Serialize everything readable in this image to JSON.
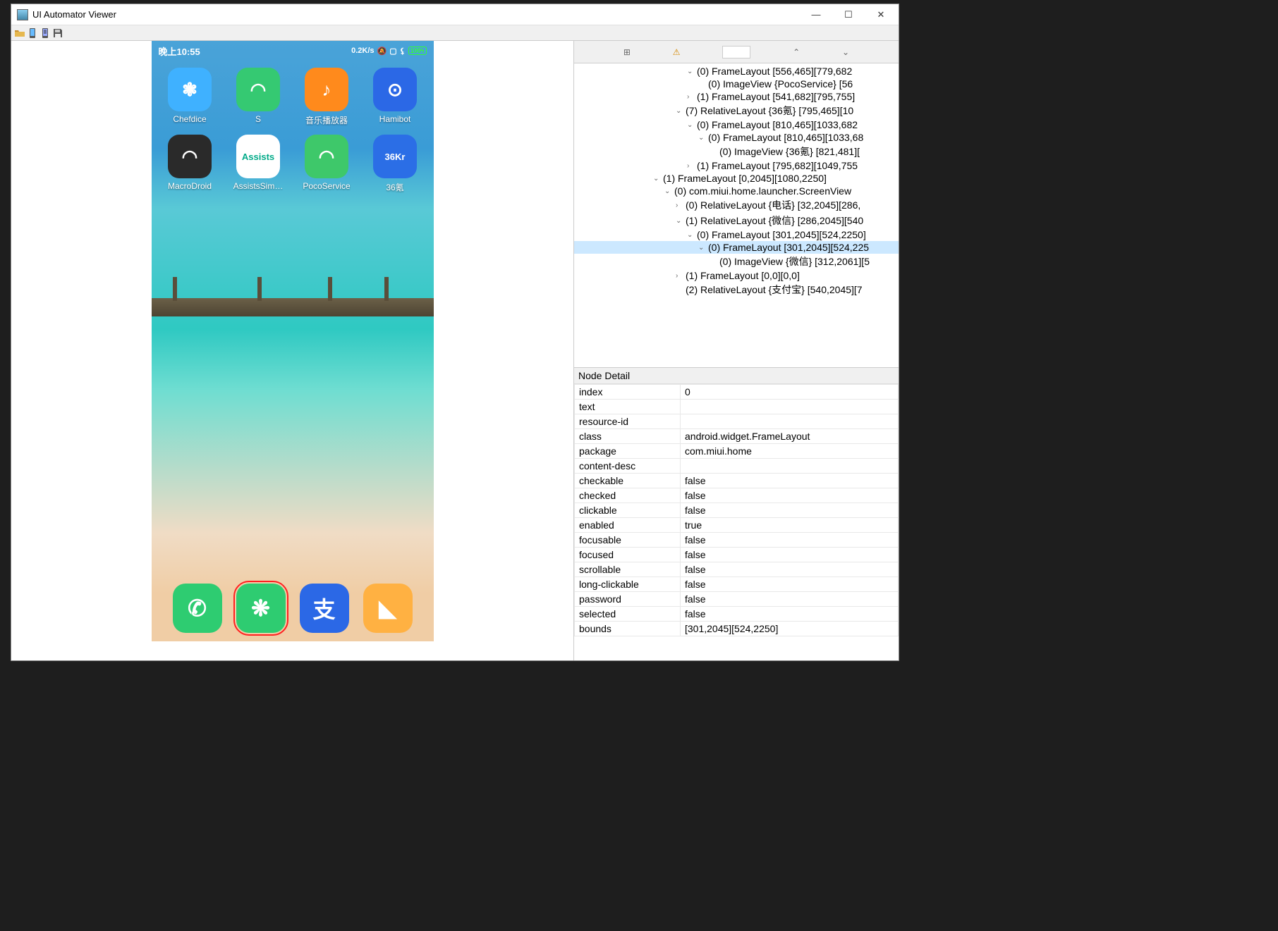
{
  "window": {
    "title": "UI Automator Viewer"
  },
  "statusbar": {
    "time": "晚上10:55",
    "speed": "0.2K/s",
    "battery": "100"
  },
  "apps_row1": [
    {
      "label": "Chefdice",
      "bg": "#3fb1ff",
      "glyph": "❃"
    },
    {
      "label": "S",
      "bg": "#35c972",
      "glyph": "◠"
    },
    {
      "label": "音乐播放器",
      "bg": "#ff8a1c",
      "glyph": "♪"
    },
    {
      "label": "Hamibot",
      "bg": "#2b68e6",
      "glyph": "⊙"
    }
  ],
  "apps_row2": [
    {
      "label": "MacroDroid",
      "bg": "#2a2a2a",
      "glyph": "◠"
    },
    {
      "label": "AssistsSim…",
      "bg": "#ffffff",
      "fg": "#0a8",
      "glyph": "Assists"
    },
    {
      "label": "PocoService",
      "bg": "#3ec86a",
      "glyph": "◠"
    },
    {
      "label": "36氪",
      "bg": "#2b6ee6",
      "glyph": "36Kr"
    }
  ],
  "dock": [
    {
      "name": "phone",
      "bg": "#2ecc71",
      "glyph": "✆"
    },
    {
      "name": "wechat",
      "bg": "#2ecc71",
      "glyph": "❋",
      "selected": true
    },
    {
      "name": "alipay",
      "bg": "#2b68e6",
      "glyph": "支"
    },
    {
      "name": "notes",
      "bg": "#ffb142",
      "glyph": "◣"
    }
  ],
  "tree": [
    {
      "indent": 10,
      "arrow": "⌄",
      "text": "(0) FrameLayout [556,465][779,682"
    },
    {
      "indent": 11,
      "arrow": "",
      "text": "(0) ImageView {PocoService} [56"
    },
    {
      "indent": 10,
      "arrow": "›",
      "text": "(1) FrameLayout [541,682][795,755]"
    },
    {
      "indent": 9,
      "arrow": "⌄",
      "text": "(7) RelativeLayout {36氪} [795,465][10"
    },
    {
      "indent": 10,
      "arrow": "⌄",
      "text": "(0) FrameLayout [810,465][1033,682"
    },
    {
      "indent": 11,
      "arrow": "⌄",
      "text": "(0) FrameLayout [810,465][1033,68"
    },
    {
      "indent": 12,
      "arrow": "",
      "text": "(0) ImageView {36氪} [821,481]["
    },
    {
      "indent": 10,
      "arrow": "›",
      "text": "(1) FrameLayout [795,682][1049,755"
    },
    {
      "indent": 7,
      "arrow": "⌄",
      "text": "(1) FrameLayout [0,2045][1080,2250]"
    },
    {
      "indent": 8,
      "arrow": "⌄",
      "text": "(0) com.miui.home.launcher.ScreenView"
    },
    {
      "indent": 9,
      "arrow": "›",
      "text": "(0) RelativeLayout {电话} [32,2045][286,"
    },
    {
      "indent": 9,
      "arrow": "⌄",
      "text": "(1) RelativeLayout {微信} [286,2045][540"
    },
    {
      "indent": 10,
      "arrow": "⌄",
      "text": "(0) FrameLayout [301,2045][524,2250]"
    },
    {
      "indent": 11,
      "arrow": "⌄",
      "text": "(0) FrameLayout [301,2045][524,225",
      "sel": true
    },
    {
      "indent": 12,
      "arrow": "",
      "text": "(0) ImageView {微信} [312,2061][5"
    },
    {
      "indent": 9,
      "arrow": "›",
      "text": "(1) FrameLayout [0,0][0,0]"
    },
    {
      "indent": 9,
      "arrow": "",
      "text": "(2) RelativeLayout {支付宝} [540,2045][7"
    }
  ],
  "detail_title": "Node Detail",
  "detail": [
    {
      "k": "index",
      "v": "0"
    },
    {
      "k": "text",
      "v": ""
    },
    {
      "k": "resource-id",
      "v": ""
    },
    {
      "k": "class",
      "v": "android.widget.FrameLayout"
    },
    {
      "k": "package",
      "v": "com.miui.home"
    },
    {
      "k": "content-desc",
      "v": ""
    },
    {
      "k": "checkable",
      "v": "false"
    },
    {
      "k": "checked",
      "v": "false"
    },
    {
      "k": "clickable",
      "v": "false"
    },
    {
      "k": "enabled",
      "v": "true"
    },
    {
      "k": "focusable",
      "v": "false"
    },
    {
      "k": "focused",
      "v": "false"
    },
    {
      "k": "scrollable",
      "v": "false"
    },
    {
      "k": "long-clickable",
      "v": "false"
    },
    {
      "k": "password",
      "v": "false"
    },
    {
      "k": "selected",
      "v": "false"
    },
    {
      "k": "bounds",
      "v": "[301,2045][524,2250]"
    }
  ]
}
